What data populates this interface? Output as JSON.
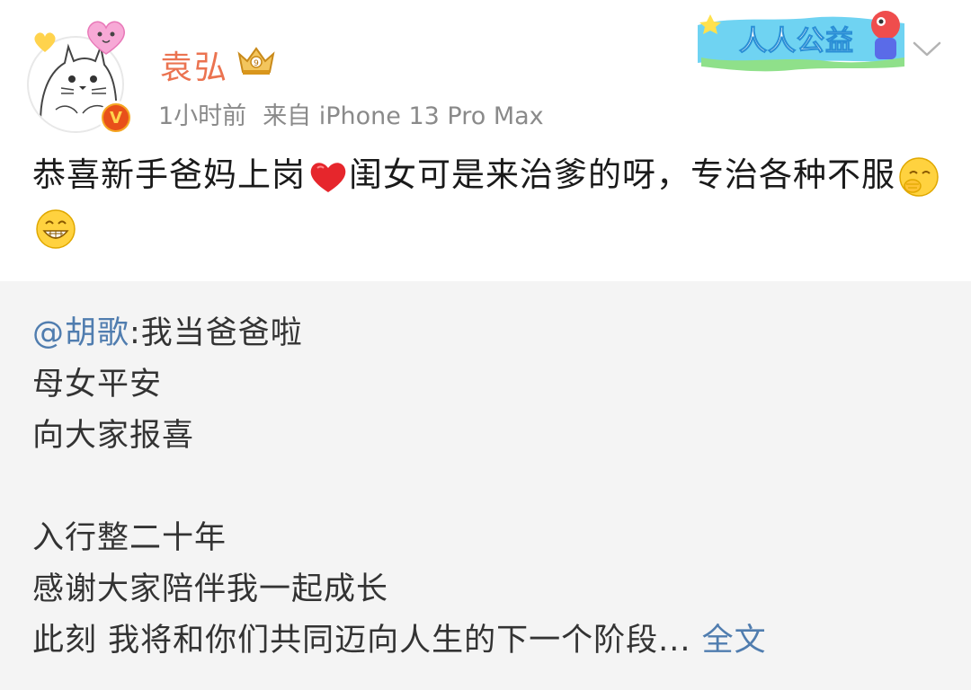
{
  "post": {
    "author": {
      "name": "袁弘",
      "verified": true
    },
    "meta": {
      "time": "1小时前",
      "source": "来自 iPhone 13 Pro Max"
    },
    "banner": {
      "label": "人人公益"
    },
    "text": "恭喜新手爸妈上岗",
    "text_after_heart": "闺女可是来治爹的呀，专治各种不服",
    "emojis": [
      "heart-emoji",
      "shy-face-emoji",
      "grin-face-emoji"
    ]
  },
  "repost": {
    "mention": "@胡歌",
    "first_line_rest": ":我当爸爸啦",
    "lines": [
      "母女平安",
      "向大家报喜",
      "",
      "入行整二十年",
      "感谢大家陪伴我一起成长"
    ],
    "last_line": "此刻 我将和你们共同迈向人生的下一个阶段...",
    "more_label": "全文"
  },
  "colors": {
    "username": "#eb7350",
    "link": "#507daf",
    "meta": "#8a8a8a",
    "repost_bg": "#f4f4f4"
  }
}
